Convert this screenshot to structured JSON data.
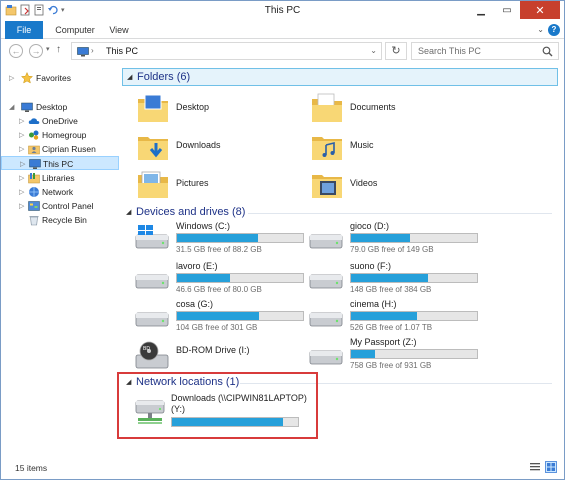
{
  "window": {
    "title": "This PC"
  },
  "ribbon": {
    "tabs": [
      "File",
      "Computer",
      "View"
    ],
    "help_label": "?"
  },
  "address": {
    "crumb": "This PC",
    "search_placeholder": "Search This PC"
  },
  "nav_pane": {
    "favorites": "Favorites",
    "desktop": "Desktop",
    "children": [
      "OneDrive",
      "Homegroup",
      "Ciprian Rusen",
      "This PC",
      "Libraries",
      "Network",
      "Control Panel",
      "Recycle Bin"
    ]
  },
  "groups": {
    "folders": "Folders (6)",
    "devices": "Devices and drives (8)",
    "network": "Network locations (1)"
  },
  "folders": [
    "Desktop",
    "Documents",
    "Downloads",
    "Music",
    "Pictures",
    "Videos"
  ],
  "drives": [
    {
      "name": "Windows (C:)",
      "free": "31.5 GB free of 88.2 GB",
      "used_fraction": 0.64
    },
    {
      "name": "gioco (D:)",
      "free": "79.0 GB free of 149 GB",
      "used_fraction": 0.47
    },
    {
      "name": "lavoro (E:)",
      "free": "46.6 GB free of 80.0 GB",
      "used_fraction": 0.42
    },
    {
      "name": "suono (F:)",
      "free": "148 GB free of 384 GB",
      "used_fraction": 0.61
    },
    {
      "name": "cosa (G:)",
      "free": "104 GB free of 301 GB",
      "used_fraction": 0.65
    },
    {
      "name": "cinema (H:)",
      "free": "526 GB free of 1.07 TB",
      "used_fraction": 0.52
    },
    {
      "name": "BD-ROM Drive (I:)",
      "free": "",
      "used_fraction": null
    },
    {
      "name": "My Passport (Z:)",
      "free": "758 GB free of 931 GB",
      "used_fraction": 0.19
    }
  ],
  "network_locations": [
    {
      "name_line1": "Downloads (\\\\CIPWIN81LAPTOP)",
      "name_line2": "(Y:)",
      "used_fraction": 0.88
    }
  ],
  "status": {
    "item_count": "15 items"
  },
  "colors": {
    "accent": "#1979ca",
    "bar_fill": "#26a0da",
    "highlight": "#d83b3b",
    "selection": "#cce8ff"
  }
}
